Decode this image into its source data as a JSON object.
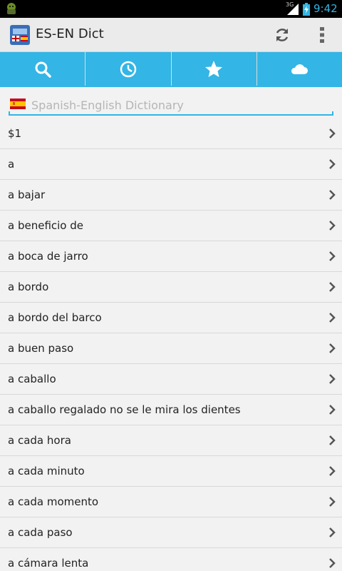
{
  "status_bar": {
    "network": "3G",
    "time": "9:42"
  },
  "action_bar": {
    "title": "ES-EN Dict",
    "refresh_icon": "refresh-icon",
    "overflow_icon": "overflow-menu-icon"
  },
  "tabs": [
    {
      "icon": "search-icon",
      "active": true
    },
    {
      "icon": "history-clock-icon",
      "active": false
    },
    {
      "icon": "favorites-star-icon",
      "active": false
    },
    {
      "icon": "cloud-icon",
      "active": false
    }
  ],
  "search": {
    "placeholder": "Spanish-English Dictionary",
    "value": ""
  },
  "words": [
    "$1",
    "a",
    "a bajar",
    "a beneficio de",
    "a boca de jarro",
    "a bordo",
    "a bordo del barco",
    "a buen paso",
    "a caballo",
    "a caballo regalado no se le mira los dientes",
    "a cada hora",
    "a cada minuto",
    "a cada momento",
    "a cada paso",
    "a cámara lenta"
  ],
  "colors": {
    "accent": "#33b5e5",
    "background": "#f2f2f2",
    "action_bar": "#ebebeb"
  }
}
